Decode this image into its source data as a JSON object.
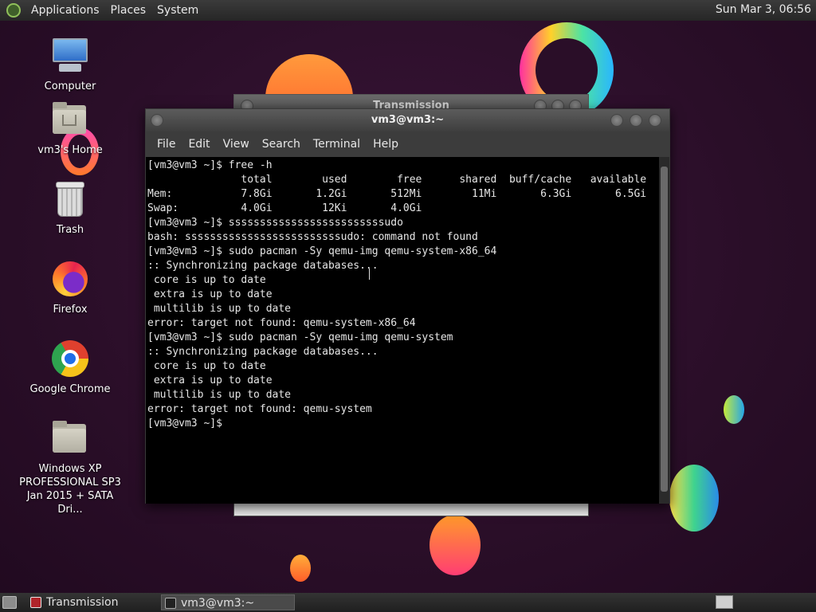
{
  "top_panel": {
    "menus": [
      "Applications",
      "Places",
      "System"
    ],
    "clock": "Sun Mar 3, 06:56"
  },
  "desktop_icons": [
    {
      "label": "Computer",
      "icon": "computer-icon"
    },
    {
      "label": "vm3's Home",
      "icon": "home-folder-icon"
    },
    {
      "label": "Trash",
      "icon": "trash-icon"
    },
    {
      "label": "Firefox",
      "icon": "firefox-icon"
    },
    {
      "label": "Google Chrome",
      "icon": "chrome-icon"
    },
    {
      "label": "Windows XP PROFESSIONAL SP3 Jan 2015 + SATA Dri...",
      "icon": "folder-icon"
    }
  ],
  "background_window": {
    "title": "Transmission"
  },
  "terminal": {
    "title": "vm3@vm3:~",
    "menus": [
      "File",
      "Edit",
      "View",
      "Search",
      "Terminal",
      "Help"
    ],
    "lines": [
      "[vm3@vm3 ~]$ free -h",
      "               total        used        free      shared  buff/cache   available",
      "Mem:           7.8Gi       1.2Gi       512Mi        11Mi       6.3Gi       6.5Gi",
      "Swap:          4.0Gi        12Ki       4.0Gi",
      "[vm3@vm3 ~]$ sssssssssssssssssssssssssudo",
      "bash: sssssssssssssssssssssssssudo: command not found",
      "[vm3@vm3 ~]$ sudo pacman -Sy qemu-img qemu-system-x86_64",
      ":: Synchronizing package databases...",
      " core is up to date",
      " extra is up to date",
      " multilib is up to date",
      "error: target not found: qemu-system-x86_64",
      "[vm3@vm3 ~]$ sudo pacman -Sy qemu-img qemu-system",
      ":: Synchronizing package databases...",
      " core is up to date",
      " extra is up to date",
      " multilib is up to date",
      "error: target not found: qemu-system",
      "[vm3@vm3 ~]$ "
    ]
  },
  "taskbar": {
    "tasks": [
      {
        "label": "Transmission",
        "active": false
      },
      {
        "label": "vm3@vm3:~",
        "active": true
      }
    ]
  }
}
